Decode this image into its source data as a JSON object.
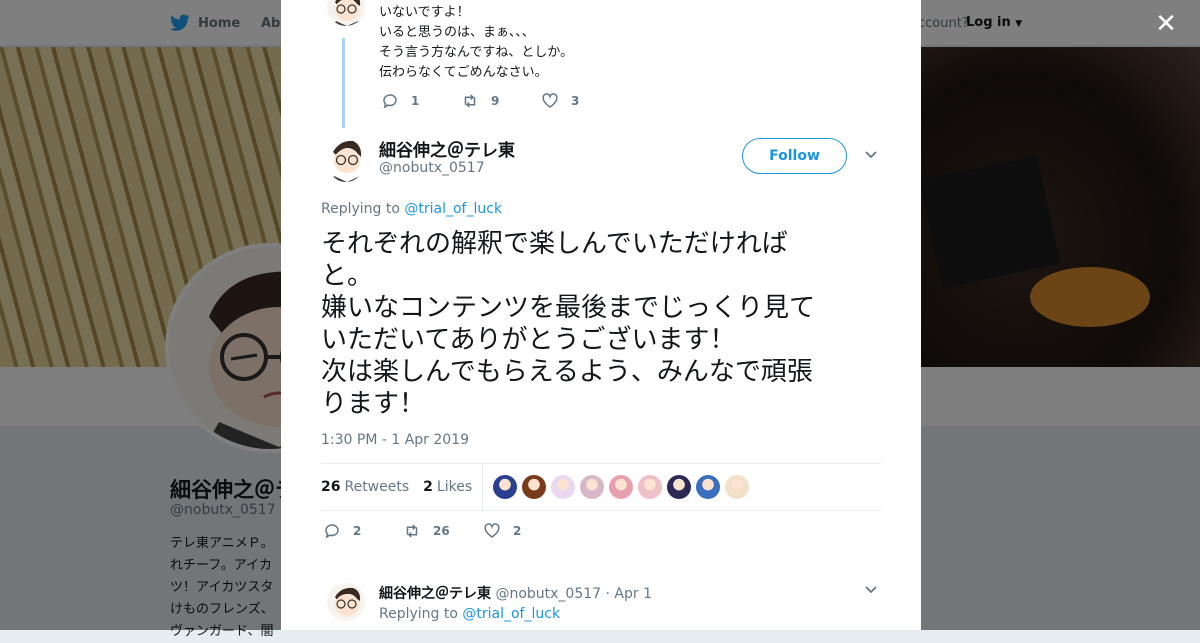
{
  "background": {
    "nav": {
      "home_label": "Home",
      "about_label": "Abo",
      "account_text": "ccount?",
      "login_label": "Log in"
    },
    "profile": {
      "name": "細谷伸之＠テ",
      "handle": "@nobutx_0517",
      "bio_lines": [
        "テレ東アニメＰ。",
        "れチーフ。アイカ",
        "ツ！アイカツスタ",
        "けものフレンズ、",
        "ヴァンガード、闇"
      ]
    }
  },
  "modal": {
    "close_icon": "close-icon",
    "previous_tweet": {
      "lines": [
        "いないですよ！",
        "いると思うのは、まぁ、、、",
        "そう言う方なんですね、としか。",
        "伝わらなくてごめんなさい。"
      ],
      "reply_count": "1",
      "retweet_count": "9",
      "like_count": "3"
    },
    "main_tweet": {
      "author_name": "細谷伸之＠テレ東",
      "author_handle": "@nobutx_0517",
      "follow_label": "Follow",
      "replying_prefix": "Replying to",
      "replying_to": "@trial_of_luck",
      "text": "それぞれの解釈で楽しんでいただければ\nと。\n嫌いなコンテンツを最後までじっくり見て\nいただいてありがとうございます！\n次は楽しんでもらえるよう、みんなで頑張\nります！",
      "timestamp": "1:30 PM - 1 Apr 2019",
      "retweets": "26",
      "retweets_label": "Retweets",
      "likes": "2",
      "likes_label": "Likes",
      "liker_colors": [
        "#2a3f8f",
        "#7a3b1c",
        "#e9d8ef",
        "#d8b8c8",
        "#e8a0b0",
        "#f0c0c8",
        "#2a2a55",
        "#3a6fc0",
        "#f2e0c8"
      ],
      "reply_count": "2",
      "retweet_count": "26",
      "like_count": "2"
    },
    "reply_tweet": {
      "author_name": "細谷伸之＠テレ東",
      "author_handle": "@nobutx_0517",
      "date": "· Apr 1",
      "replying_prefix": "Replying to",
      "replying_to": "@trial_of_luck"
    }
  },
  "colors": {
    "accent": "#1b95e0",
    "thread_line": "#a6d4f2",
    "muted": "#657786"
  }
}
